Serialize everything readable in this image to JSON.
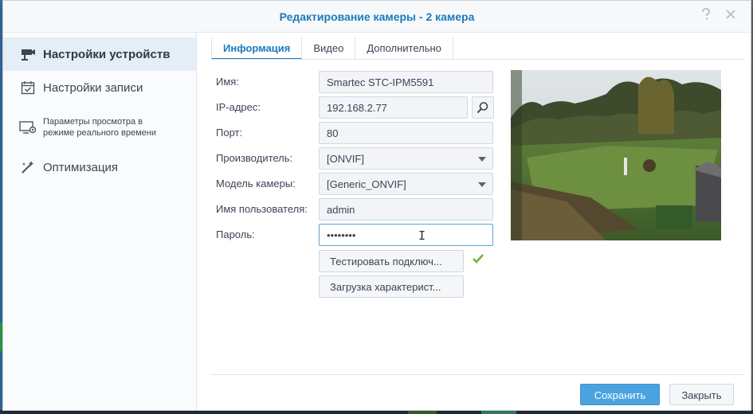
{
  "dialog": {
    "title": "Редактирование камеры - 2 камера",
    "help_icon": "help-icon",
    "close_icon": "close-icon"
  },
  "sidebar": {
    "items": [
      {
        "label": "Настройки устройств",
        "icon": "camera-icon",
        "active": true
      },
      {
        "label": "Настройки записи",
        "icon": "calendar-check-icon",
        "active": false
      },
      {
        "label": "Параметры просмотра в режиме реального времени",
        "line1": "Параметры просмотра в",
        "line2": "режиме реального времени",
        "icon": "monitor-camera-icon",
        "active": false
      },
      {
        "label": "Оптимизация",
        "icon": "magic-wand-icon",
        "active": false
      }
    ]
  },
  "tabs": [
    {
      "label": "Информация",
      "active": true
    },
    {
      "label": "Видео",
      "active": false
    },
    {
      "label": "Дополнительно",
      "active": false
    }
  ],
  "form": {
    "name": {
      "label": "Имя:",
      "value": "Smartec STC-IPM5591"
    },
    "ip": {
      "label": "IP-адрес:",
      "value": "192.168.2.77"
    },
    "port": {
      "label": "Порт:",
      "value": "80"
    },
    "vendor": {
      "label": "Производитель:",
      "value": "[ONVIF]"
    },
    "model": {
      "label": "Модель камеры:",
      "value": "[Generic_ONVIF]"
    },
    "username": {
      "label": "Имя пользователя:",
      "value": "admin"
    },
    "password": {
      "label": "Пароль:",
      "value": "••••••••"
    },
    "test_button": "Тестировать подключ...",
    "load_button": "Загрузка характерист..."
  },
  "footer": {
    "save": "Сохранить",
    "close": "Закрыть"
  },
  "colors": {
    "accent": "#1b7bbd",
    "save_button": "#4aa3df",
    "success": "#6cb33e"
  }
}
